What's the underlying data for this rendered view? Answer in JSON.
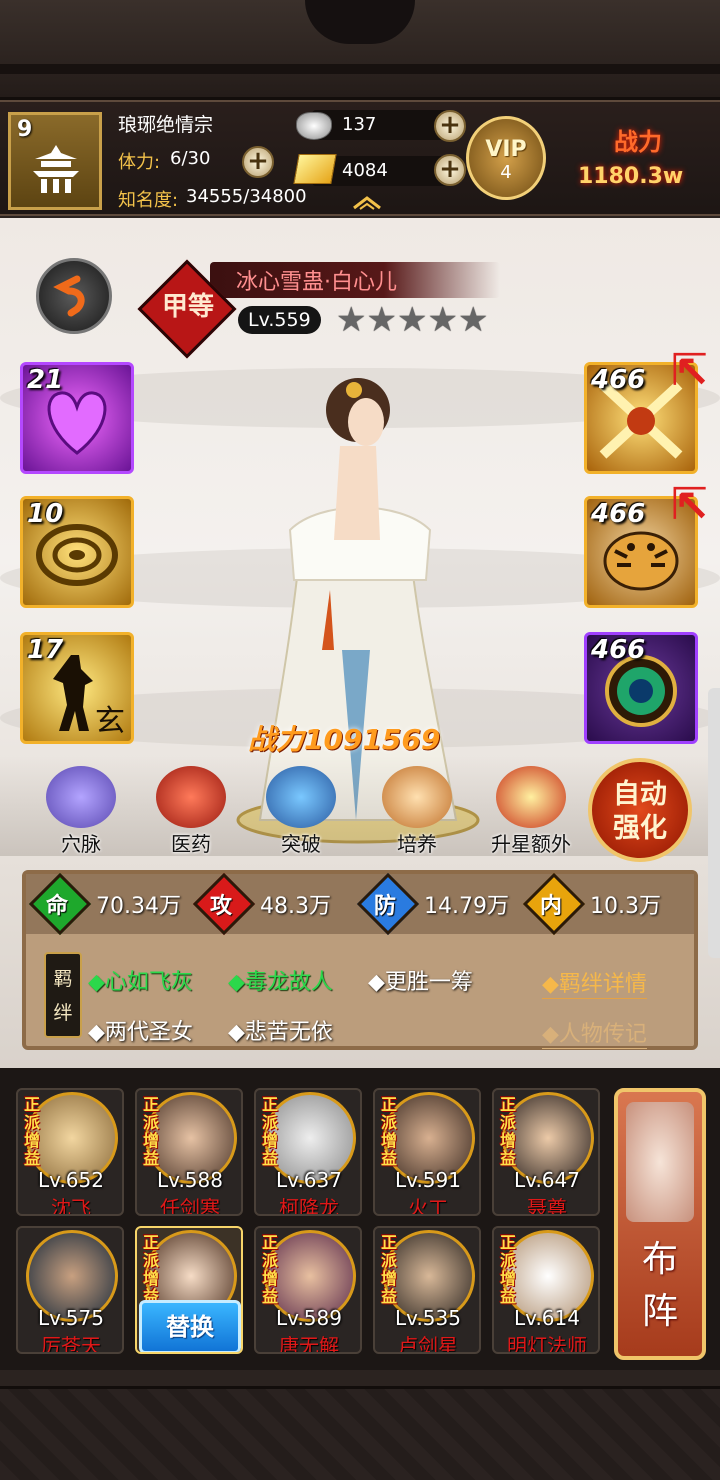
{
  "header": {
    "sect_level": "9",
    "sect_name": "琅琊绝情宗",
    "stamina_label": "体力:",
    "stamina_value": "6/30",
    "fame_label": "知名度:",
    "fame_value": "34555/34800",
    "silver": "137",
    "gold": "4084",
    "vip_text": "VIP",
    "vip_level": "4",
    "combat_label": "战力",
    "combat_value": "1180.3w"
  },
  "hero": {
    "grade": "甲等",
    "name": "冰心雪蛊·白心儿",
    "level": "Lv.559",
    "stars_total": 5,
    "stars_filled": 0,
    "power": "战力1091569"
  },
  "skills_left": [
    {
      "count": "21",
      "icon": "purple-heart-skill",
      "color": "#8a2bd4"
    },
    {
      "count": "10",
      "icon": "golden-vortex-skill",
      "color": "#e8a40c"
    },
    {
      "count": "17",
      "icon": "golden-silhouette-skill",
      "color": "#e8a40c"
    }
  ],
  "equipment_right": [
    {
      "count": "466",
      "icon": "crossed-blades-equipment",
      "upgradable": true
    },
    {
      "count": "466",
      "icon": "tiger-equipment",
      "upgradable": true
    },
    {
      "count": "466",
      "icon": "jade-orb-equipment",
      "upgradable": false
    }
  ],
  "actions": [
    {
      "label": "穴脉",
      "icon": "meridian-icon"
    },
    {
      "label": "医药",
      "icon": "medicine-icon"
    },
    {
      "label": "突破",
      "icon": "breakthrough-icon"
    },
    {
      "label": "培养",
      "icon": "training-icon"
    },
    {
      "label": "升星额外",
      "icon": "star-upgrade-icon"
    }
  ],
  "auto_enhance": {
    "line1": "自动",
    "line2": "强化"
  },
  "stats": [
    {
      "gem": "命",
      "value": "70.34万",
      "color": "#1ea82c"
    },
    {
      "gem": "攻",
      "value": "48.3万",
      "color": "#d81a1a"
    },
    {
      "gem": "防",
      "value": "14.79万",
      "color": "#2a7be0"
    },
    {
      "gem": "内",
      "value": "10.3万",
      "color": "#e8a40c"
    }
  ],
  "bonds": {
    "tag_line1": "羁",
    "tag_line2": "绊",
    "items": [
      {
        "text": "◆心如飞灰",
        "active": true
      },
      {
        "text": "◆毒龙故人",
        "active": true
      },
      {
        "text": "◆更胜一筹",
        "active": false
      },
      {
        "text": "◆两代圣女",
        "active": false
      },
      {
        "text": "◆悲苦无依",
        "active": false
      }
    ],
    "detail_link": "◆羁绊详情",
    "bio_link": "◆人物传记"
  },
  "lineup": [
    {
      "level": "Lv.652",
      "name": "沈飞",
      "tag": "正派增益"
    },
    {
      "level": "Lv.588",
      "name": "任剑寒",
      "tag": "正派增益"
    },
    {
      "level": "Lv.637",
      "name": "柯降龙",
      "tag": "正派增益"
    },
    {
      "level": "Lv.591",
      "name": "火工",
      "tag": "正派增益"
    },
    {
      "level": "Lv.647",
      "name": "聂尊",
      "tag": "正派增益"
    },
    {
      "level": "Lv.575",
      "name": "厉苍天",
      "tag": ""
    },
    {
      "level": "",
      "name": "",
      "tag": "正派增益",
      "replace_label": "替换"
    },
    {
      "level": "Lv.589",
      "name": "唐无解",
      "tag": "正派增益"
    },
    {
      "level": "Lv.535",
      "name": "卢剑星",
      "tag": "正派增益"
    },
    {
      "level": "Lv.614",
      "name": "明灯法师",
      "tag": "正派增益"
    }
  ],
  "formation": {
    "line1": "布",
    "line2": "阵"
  }
}
